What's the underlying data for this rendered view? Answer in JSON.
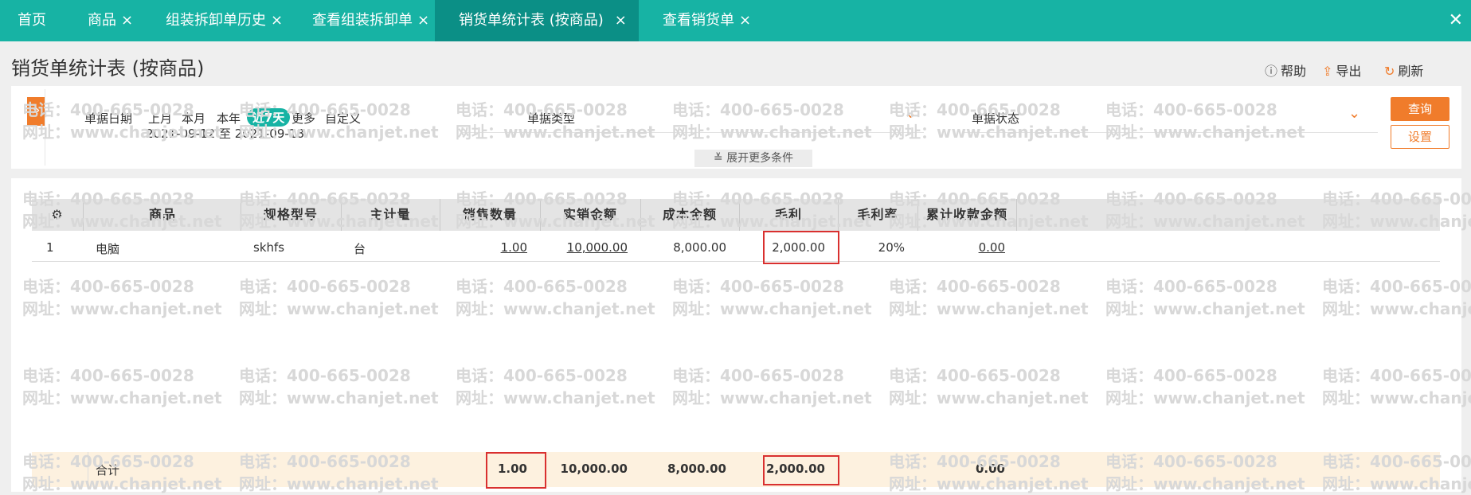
{
  "tabs": [
    {
      "label": "首页",
      "closable": false
    },
    {
      "label": "商品",
      "closable": true
    },
    {
      "label": "组装拆卸单历史",
      "closable": true
    },
    {
      "label": "查看组装拆卸单",
      "closable": true
    },
    {
      "label": "销货单统计表 (按商品)",
      "closable": true,
      "active": true
    },
    {
      "label": "查看销货单",
      "closable": true
    }
  ],
  "window_close": "✕",
  "page_title": "销货单统计表 (按商品)",
  "toolbar": {
    "help": "帮助",
    "export": "导出",
    "refresh": "刷新"
  },
  "filter": {
    "date_label": "单据日期",
    "date_options": [
      "上月",
      "本月",
      "本年",
      "近7天",
      "更多",
      "自定义"
    ],
    "selected_option": "近7天",
    "date_range": "2021-09-12 至 2021-09-18",
    "doc_type_label": "单据类型",
    "doc_status_label": "单据状态",
    "query_button": "查询",
    "settings_button": "设置",
    "more_conditions": "展开更多条件"
  },
  "table": {
    "columns": [
      "商品",
      "规格型号",
      "主计量",
      "销售数量",
      "实销金额",
      "成本金额",
      "毛利",
      "毛利率",
      "累计收款金额"
    ],
    "rows": [
      {
        "index": "1",
        "product": "电脑",
        "spec": "skhfs",
        "unit": "台",
        "qty": "1.00",
        "sales_amount": "10,000.00",
        "cost_amount": "8,000.00",
        "gross_profit": "2,000.00",
        "margin": "20%",
        "received": "0.00"
      }
    ],
    "totals": {
      "label": "合计",
      "qty": "1.00",
      "sales_amount": "10,000.00",
      "cost_amount": "8,000.00",
      "gross_profit": "2,000.00",
      "received": "0.00"
    }
  },
  "watermark": {
    "phone": "电话：400-665-0028",
    "site": "网址：www.chanjet.net"
  },
  "colors": {
    "tab_bar": "#17b3a4",
    "tab_active": "#0b8f86",
    "accent": "#f07c2b",
    "highlight_box": "#d9302f",
    "totals_bg": "#fdf1df"
  }
}
